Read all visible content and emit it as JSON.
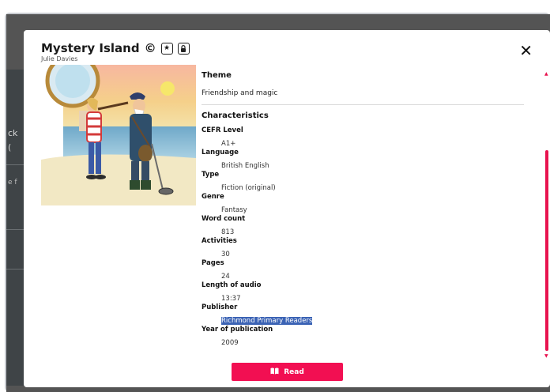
{
  "book": {
    "title": "Mystery Island",
    "copyright_symbol": "©",
    "star_tag": "★",
    "lock_tag": "🔒",
    "author": "Julie Davies"
  },
  "close_label": "✕",
  "theme": {
    "heading": "Theme",
    "text": "Friendship and magic"
  },
  "characteristics": {
    "heading": "Characteristics",
    "rows": [
      {
        "label": "CEFR Level",
        "value": "A1+"
      },
      {
        "label": "Language",
        "value": "British English"
      },
      {
        "label": "Type",
        "value": "Fiction (original)"
      },
      {
        "label": "Genre",
        "value": "Fantasy"
      },
      {
        "label": "Word count",
        "value": "813"
      },
      {
        "label": "Activities",
        "value": "30"
      },
      {
        "label": "Pages",
        "value": "24"
      },
      {
        "label": "Length of audio",
        "value": "13:37"
      },
      {
        "label": "Publisher",
        "value": "Richmond Primary Readers"
      },
      {
        "label": "Year of publication",
        "value": "2009"
      }
    ]
  },
  "read_button": {
    "label": "Read",
    "icon": "book-icon"
  },
  "background": {
    "text_1": "ck",
    "text_2": "(",
    "text_3": "e f"
  },
  "colors": {
    "accent": "#f20f52",
    "selection": "#3b63b5"
  }
}
